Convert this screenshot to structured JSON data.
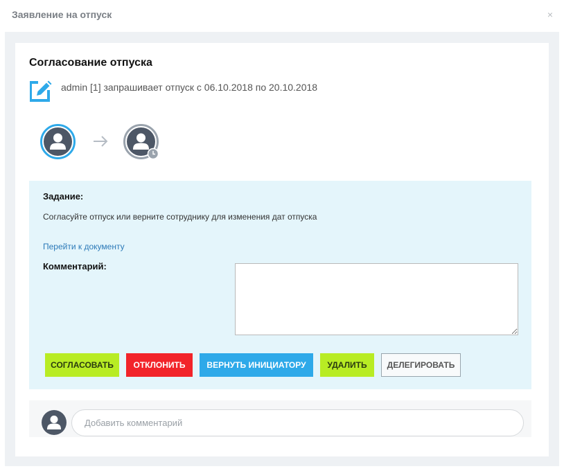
{
  "dialog": {
    "title": "Заявление на отпуск",
    "close_glyph": "×"
  },
  "card": {
    "title": "Согласование отпуска",
    "request_text": "admin [1] запрашивает отпуск с 06.10.2018 по 20.10.2018"
  },
  "workflow": {
    "icons": [
      "user-avatar-icon",
      "arrow-right-icon",
      "user-avatar-pending-icon"
    ]
  },
  "task": {
    "label": "Задание:",
    "text": "Согласуйте отпуск или верните сотруднику для изменения дат отпуска",
    "doc_link": "Перейти к документу",
    "comment_label": "Комментарий:",
    "comment_value": ""
  },
  "buttons": {
    "approve": "СОГЛАСОВАТЬ",
    "reject": "ОТКЛОНИТЬ",
    "return": "ВЕРНУТЬ ИНИЦИАТОРУ",
    "delete": "УДАЛИТЬ",
    "delegate": "ДЕЛЕГИРОВАТЬ"
  },
  "comments": {
    "placeholder": "Добавить комментарий"
  },
  "colors": {
    "approve": "#b8ec24",
    "reject": "#f2242a",
    "return": "#2ea9e9",
    "accent": "#2ea9e9",
    "task_panel": "#e4f5fb"
  }
}
